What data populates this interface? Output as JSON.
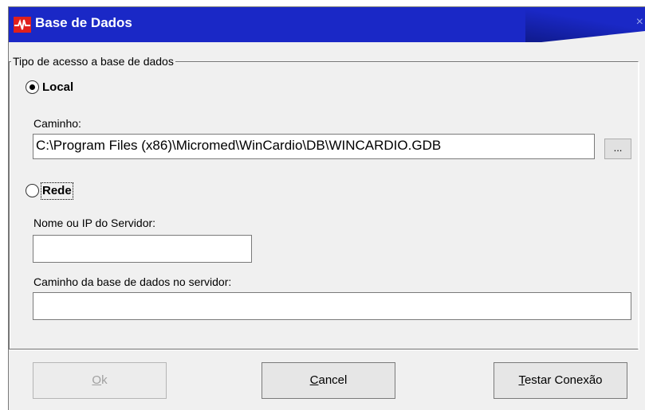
{
  "window": {
    "title": "Base de Dados",
    "close_glyph": "×"
  },
  "access_group": {
    "legend": "Tipo de acesso a base de dados"
  },
  "local": {
    "label": "Local",
    "selected": true,
    "path_label": "Caminho:",
    "path_value": "C:\\Program Files (x86)\\Micromed\\WinCardio\\DB\\WINCARDIO.GDB",
    "browse_label": "..."
  },
  "network": {
    "label": "Rede",
    "selected": false,
    "server_label": "Nome ou IP do Servidor:",
    "server_value": "",
    "db_path_label": "Caminho da base de dados no servidor:",
    "db_path_value": ""
  },
  "buttons": {
    "ok": {
      "label_first": "O",
      "label_rest": "k",
      "enabled": false
    },
    "cancel": {
      "label_first": "C",
      "label_rest": "ancel"
    },
    "test": {
      "label_first": "T",
      "label_rest": "estar Conexão"
    }
  }
}
